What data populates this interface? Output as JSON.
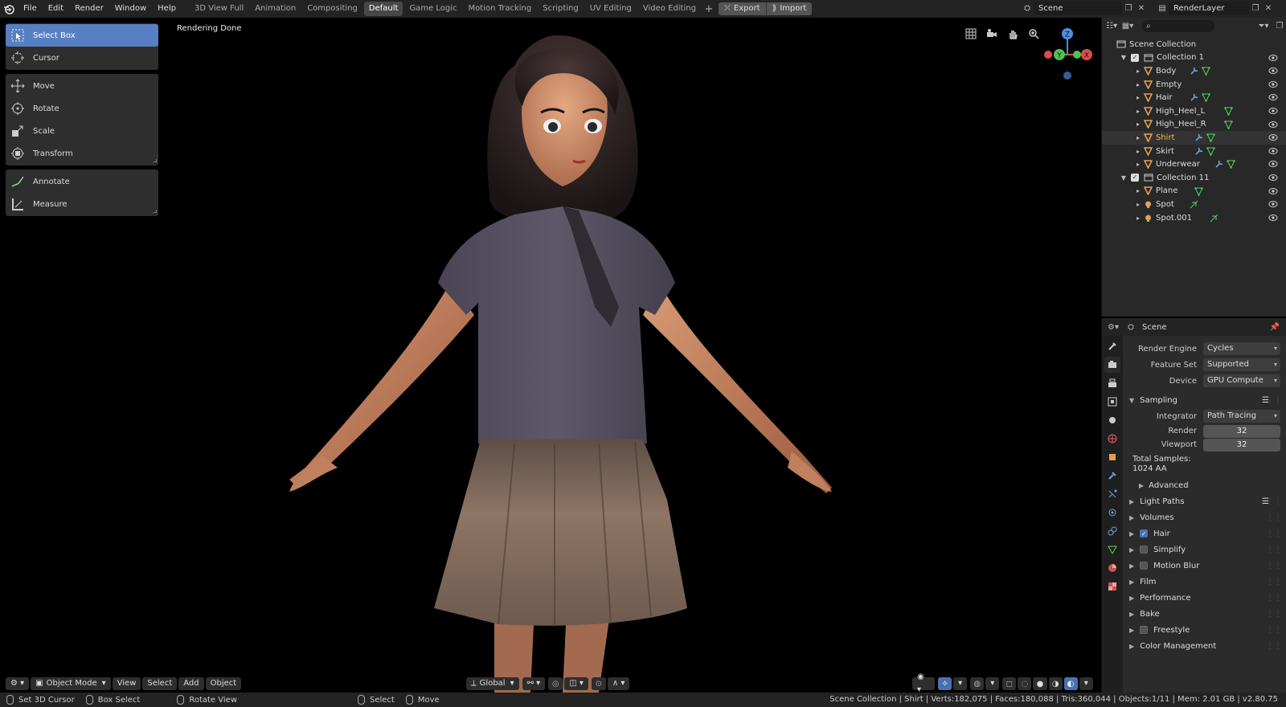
{
  "menu": [
    "File",
    "Edit",
    "Render",
    "Window",
    "Help"
  ],
  "workspaces": [
    {
      "label": "3D View Full",
      "active": false
    },
    {
      "label": "Animation",
      "active": false
    },
    {
      "label": "Compositing",
      "active": false
    },
    {
      "label": "Default",
      "active": true
    },
    {
      "label": "Game Logic",
      "active": false
    },
    {
      "label": "Motion Tracking",
      "active": false
    },
    {
      "label": "Scripting",
      "active": false
    },
    {
      "label": "UV Editing",
      "active": false
    },
    {
      "label": "Video Editing",
      "active": false
    }
  ],
  "buttons": {
    "export": "Export",
    "import": "Import"
  },
  "scene": {
    "name": "Scene"
  },
  "layer": {
    "name": "RenderLayer"
  },
  "tools": {
    "select_box": "Select Box",
    "cursor": "Cursor",
    "move": "Move",
    "rotate": "Rotate",
    "scale": "Scale",
    "transform": "Transform",
    "annotate": "Annotate",
    "measure": "Measure"
  },
  "viewport": {
    "status": "Rendering Done"
  },
  "vp_header": {
    "mode": "Object Mode",
    "view": "View",
    "select": "Select",
    "add": "Add",
    "object": "Object",
    "orientation": "Global"
  },
  "gizmo": {
    "z": "Z",
    "y": "Y",
    "x": "X"
  },
  "outliner": {
    "root": "Scene Collection",
    "collections": [
      {
        "name": "Collection 1",
        "items": [
          {
            "name": "Body",
            "mods": 2
          },
          {
            "name": "Empty",
            "mods": 0
          },
          {
            "name": "Hair",
            "mods": 2
          },
          {
            "name": "High_Heel_L",
            "mods": 1
          },
          {
            "name": "High_Heel_R",
            "mods": 1
          },
          {
            "name": "Shirt",
            "mods": 2,
            "selected": true
          },
          {
            "name": "Skirt",
            "mods": 2
          },
          {
            "name": "Underwear",
            "mods": 2
          }
        ]
      },
      {
        "name": "Collection 11",
        "items": [
          {
            "name": "Plane",
            "mods": 1,
            "type": "mesh"
          },
          {
            "name": "Spot",
            "mods": 1,
            "type": "light"
          },
          {
            "name": "Spot.001",
            "mods": 1,
            "type": "light"
          }
        ]
      }
    ]
  },
  "props": {
    "header": "Scene",
    "render_engine": {
      "label": "Render Engine",
      "value": "Cycles"
    },
    "feature_set": {
      "label": "Feature Set",
      "value": "Supported"
    },
    "device": {
      "label": "Device",
      "value": "GPU Compute"
    },
    "sampling": "Sampling",
    "integrator": {
      "label": "Integrator",
      "value": "Path Tracing"
    },
    "render": {
      "label": "Render",
      "value": "32"
    },
    "viewport": {
      "label": "Viewport",
      "value": "32"
    },
    "total_samples": "Total Samples:",
    "total_value": "1024 AA",
    "advanced": "Advanced",
    "light_paths": "Light Paths",
    "volumes": "Volumes",
    "hair": "Hair",
    "simplify": "Simplify",
    "motion_blur": "Motion Blur",
    "film": "Film",
    "performance": "Performance",
    "bake": "Bake",
    "freestyle": "Freestyle",
    "color_management": "Color Management"
  },
  "statusbar": {
    "left": [
      {
        "label": "Set 3D Cursor"
      },
      {
        "label": "Box Select"
      },
      {
        "label": "Rotate View"
      },
      {
        "label": "Select"
      },
      {
        "label": "Move"
      }
    ],
    "right": "Scene Collection | Shirt | Verts:182,075 | Faces:180,088 | Tris:360,044 | Objects:1/11 | Mem: 2.01 GB | v2.80.75"
  },
  "colors": {
    "accent": "#5680c2",
    "selected_text": "#f5b93c",
    "mesh_icon": "#e59f50",
    "modifier": "#6fa2dd",
    "vertex": "#55d05a"
  }
}
